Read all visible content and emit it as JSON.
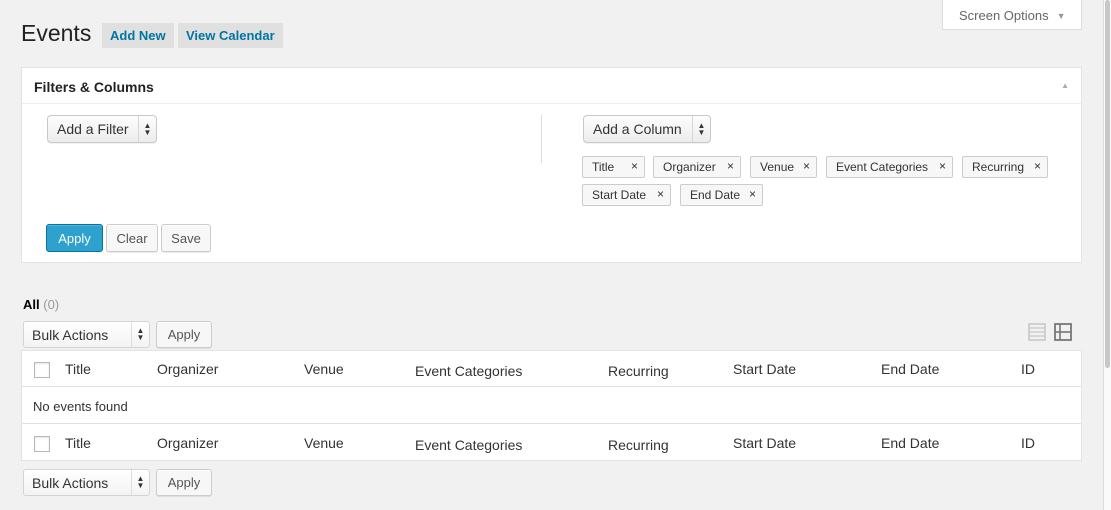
{
  "header": {
    "title": "Events",
    "add_new": "Add New",
    "view_calendar": "View Calendar",
    "screen_options": "Screen Options"
  },
  "filters_panel": {
    "title": "Filters & Columns",
    "add_filter": "Add a Filter",
    "add_column": "Add a Column",
    "columns": [
      "Title",
      "Organizer",
      "Venue",
      "Event Categories",
      "Recurring",
      "Start Date",
      "End Date"
    ],
    "apply": "Apply",
    "clear": "Clear",
    "save": "Save"
  },
  "views": {
    "all_label": "All",
    "all_count": "(0)"
  },
  "bulk": {
    "label": "Bulk Actions",
    "apply": "Apply"
  },
  "table": {
    "columns": [
      "Title",
      "Organizer",
      "Venue",
      "Event Categories",
      "Recurring",
      "Start Date",
      "End Date",
      "ID"
    ],
    "empty_message": "No events found"
  },
  "colors": {
    "primary": "#2ea2cc",
    "link": "#0074a2",
    "background": "#f1f1f1"
  }
}
